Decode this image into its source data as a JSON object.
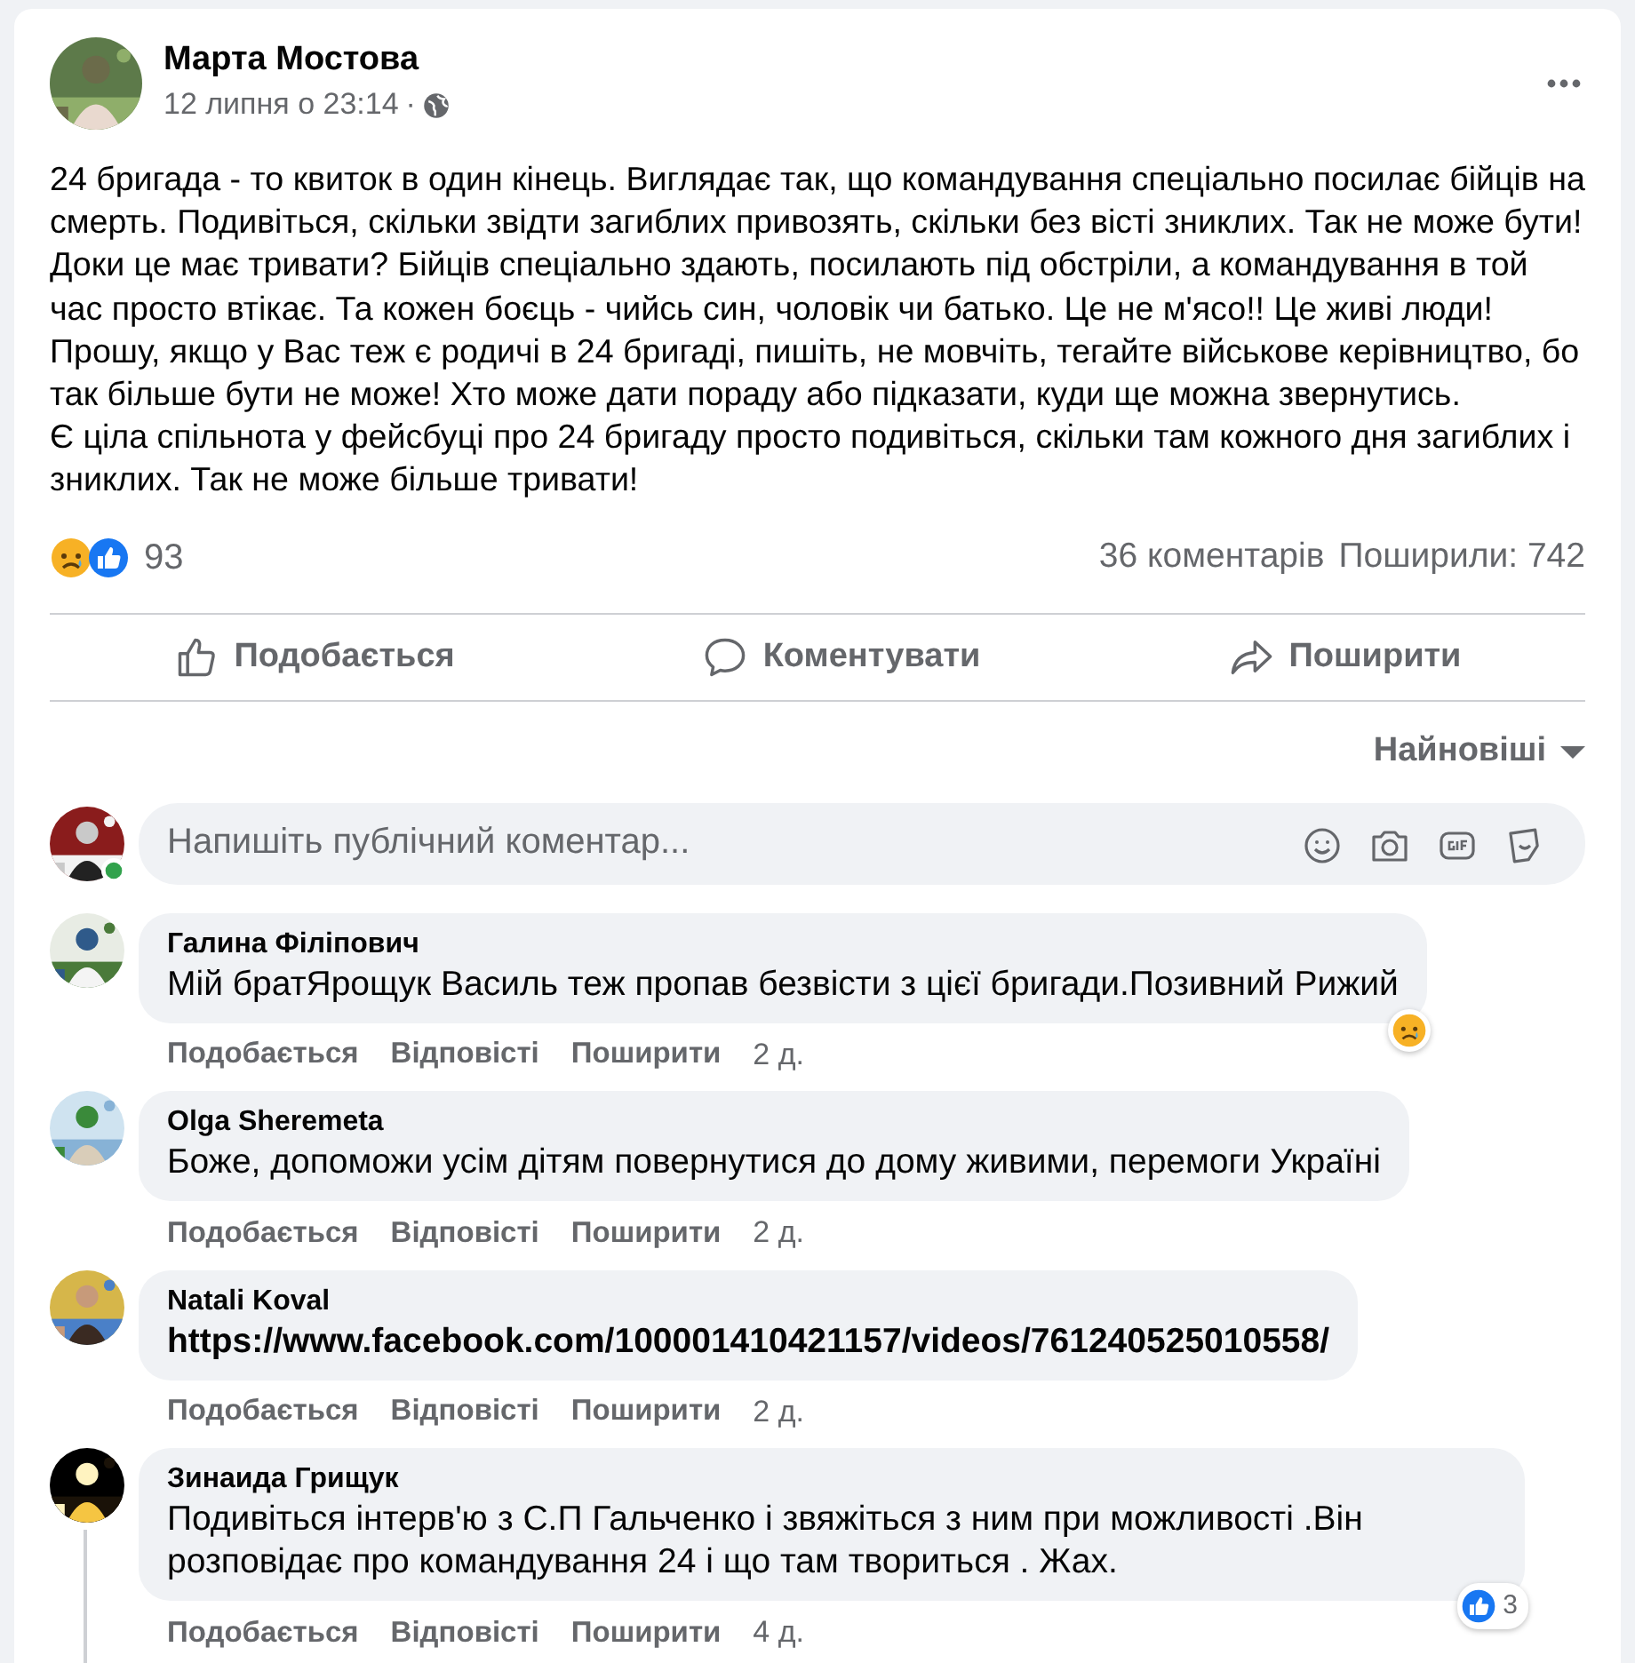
{
  "post": {
    "author": "Марта Мостова",
    "timestamp": "12 липня о 23:14",
    "separator": "·",
    "paragraphs": [
      "24 бригада - то квиток в один кінець. Виглядає так, що командування спеціально посилає бійців на смерть. Подивіться, скільки звідти загиблих привозять, скільки без вісті зниклих. Так не може бути! Доки це має тривати? Бійців спеціально здають, посилають під обстріли, а командування в той час просто втікає. Та кожен боєць - чийсь син, чоловік чи батько. Це не м'ясо!! Це живі люди! Прошу, якщо у Вас теж є родичі в 24 бригаді, пишіть, не мовчіть, тегайте військове керівництво, бо так більше бути не може! Хто може дати пораду або підказати, куди ще можна звернутись.",
      "Є ціла спільнота у фейсбуці про 24 бригаду просто подивіться, скільки там кожного дня загиблих і зниклих. Так не може більше тривати!"
    ],
    "reactions": [
      {
        "kind": "sad"
      },
      {
        "kind": "like"
      }
    ],
    "reaction_count": "93",
    "comments_count": "36 коментарів",
    "shares": "Поширили: 742"
  },
  "actions": [
    {
      "kind": "like",
      "label": "Подобається"
    },
    {
      "kind": "comment",
      "label": "Коментувати"
    },
    {
      "kind": "share",
      "label": "Поширити"
    }
  ],
  "sort": "Найновіші",
  "composer": {
    "placeholder": "Напишіть публічний коментар...",
    "online": true,
    "tools": [
      {
        "kind": "emoji"
      },
      {
        "kind": "camera"
      },
      {
        "kind": "gif"
      },
      {
        "kind": "sticker"
      }
    ]
  },
  "comments": [
    {
      "author": "Галина Філіпович",
      "text": "Мій братЯрощук Василь теж пропав безвісти з цієї бригади.Позивний Рижий",
      "link": false,
      "thread": false,
      "actions": [
        "Подобається",
        "Відповісті",
        "Поширити"
      ],
      "time": "2 д.",
      "reaction": {
        "kind": "sad"
      }
    },
    {
      "author": "Olga Sheremeta",
      "text": "Боже, допоможи усім дітям повернутися до дому живими, перемоги Україні",
      "link": false,
      "thread": false,
      "actions": [
        "Подобається",
        "Відповісті",
        "Поширити"
      ],
      "time": "2 д."
    },
    {
      "author": "Natali Koval",
      "text": "https://www.facebook.com/100001410421157/videos/761240525010558/",
      "link": true,
      "thread": false,
      "actions": [
        "Подобається",
        "Відповісті",
        "Поширити"
      ],
      "time": "2 д."
    },
    {
      "author": "Зинаида Грищук",
      "text": "Подивіться інтерв'ю з С.П Гальченко і звяжіться з ним при можливості .Він розповідає про командування 24 і що там твориться . Жах.",
      "link": false,
      "thread": true,
      "actions": [
        "Подобається",
        "Відповісті",
        "Поширити"
      ],
      "time": "4 д.",
      "reaction": {
        "kind": "like",
        "count": "3"
      }
    }
  ]
}
